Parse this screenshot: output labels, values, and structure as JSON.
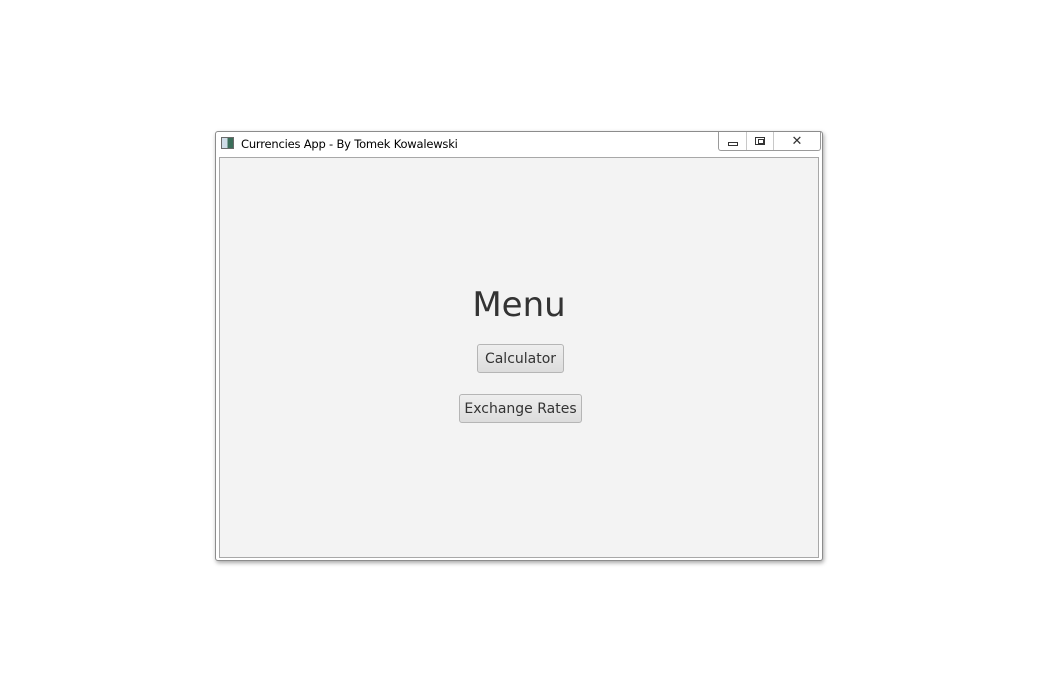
{
  "window": {
    "title": "Currencies App - By Tomek Kowalewski",
    "app_icon": "app-window-icon",
    "controls": {
      "minimize": "minimize-icon",
      "maximize": "maximize-icon",
      "close": "close-icon"
    }
  },
  "main": {
    "heading": "Menu",
    "buttons": {
      "calculator": "Calculator",
      "exchange_rates": "Exchange Rates"
    }
  },
  "colors": {
    "client_background": "#f3f3f3",
    "heading_text": "#333333",
    "button_border": "#b5b5b5"
  }
}
